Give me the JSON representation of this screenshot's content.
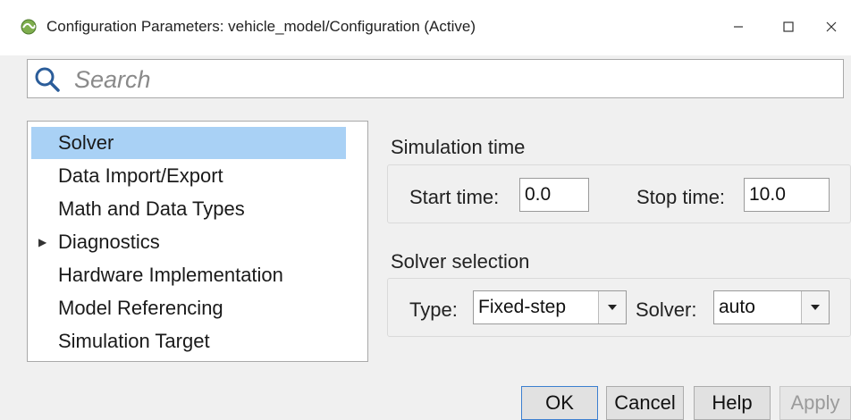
{
  "window": {
    "title": "Configuration Parameters: vehicle_model/Configuration (Active)",
    "app_icon": "simulink-icon",
    "controls": {
      "minimize": "—",
      "maximize": "☐",
      "close": "✕"
    }
  },
  "search": {
    "placeholder": "Search",
    "value": "",
    "icon": "search-icon"
  },
  "tree": {
    "items": [
      {
        "label": "Solver",
        "selected": true,
        "expandable": false
      },
      {
        "label": "Data Import/Export",
        "selected": false,
        "expandable": false
      },
      {
        "label": "Math and Data Types",
        "selected": false,
        "expandable": false
      },
      {
        "label": "Diagnostics",
        "selected": false,
        "expandable": true
      },
      {
        "label": "Hardware Implementation",
        "selected": false,
        "expandable": false
      },
      {
        "label": "Model Referencing",
        "selected": false,
        "expandable": false
      },
      {
        "label": "Simulation Target",
        "selected": false,
        "expandable": false
      }
    ]
  },
  "simulation_time": {
    "group_label": "Simulation time",
    "start_label": "Start time:",
    "start_value": "0.0",
    "stop_label": "Stop time:",
    "stop_value": "10.0"
  },
  "solver_selection": {
    "group_label": "Solver selection",
    "type_label": "Type:",
    "type_value": "Fixed-step",
    "solver_label": "Solver:",
    "solver_value": "auto"
  },
  "buttons": {
    "ok": "OK",
    "cancel": "Cancel",
    "help": "Help",
    "apply": "Apply"
  },
  "colors": {
    "selection": "#a9d1f5",
    "background": "#f0f0f0",
    "disabled_text": "#9b9b9b"
  }
}
